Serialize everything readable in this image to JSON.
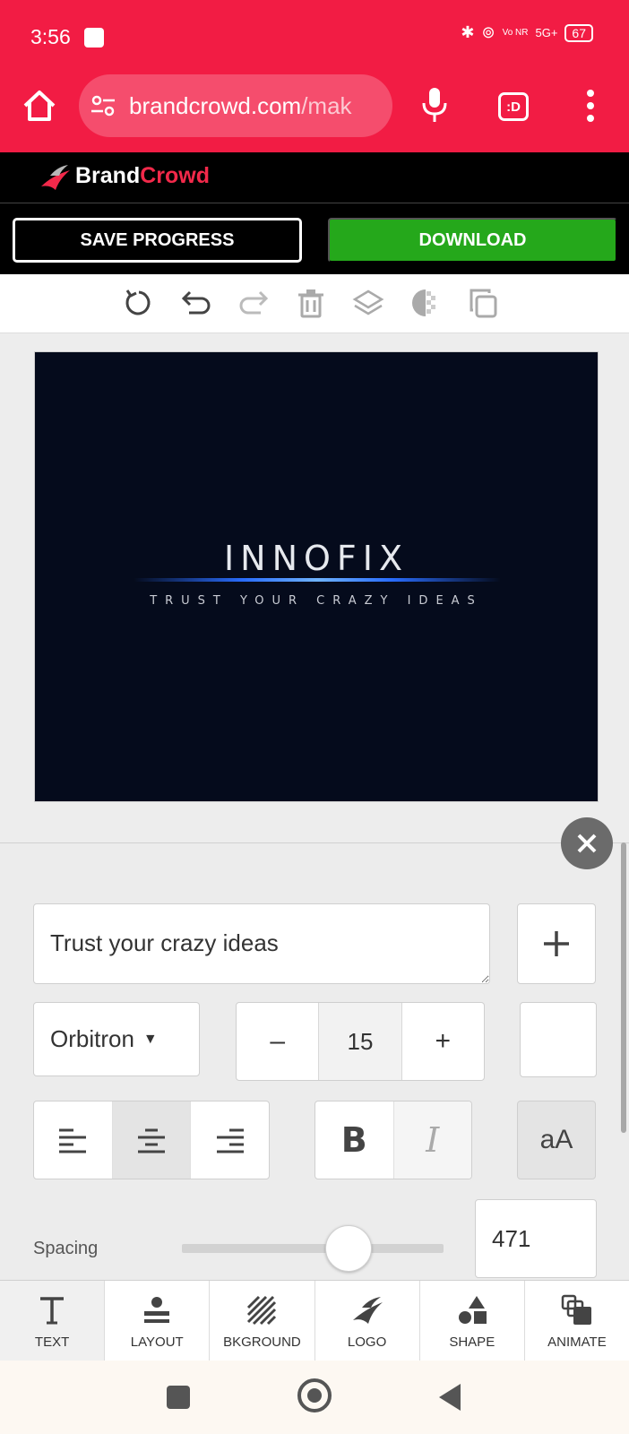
{
  "status_bar": {
    "time": "3:56",
    "network": "5G+",
    "volte": "Vo NR",
    "battery": "67"
  },
  "browser": {
    "url_main": "brandcrowd.com",
    "url_rest": "/mak",
    "tab_icon_label": ":D",
    "icons": [
      "home-icon",
      "site-settings-icon",
      "mic-icon",
      "tab-switcher-icon",
      "menu-icon"
    ]
  },
  "brand": {
    "name_part1": "Brand",
    "name_part2": "Crowd",
    "accent_color": "#f2294a"
  },
  "actions": {
    "save_label": "SAVE PROGRESS",
    "download_label": "DOWNLOAD",
    "download_color": "#25a81b"
  },
  "toolbar": {
    "icons": [
      "reset-icon",
      "undo-icon",
      "redo-icon",
      "delete-icon",
      "layers-icon",
      "transparency-icon",
      "duplicate-icon"
    ]
  },
  "artboard": {
    "background": "#050b1c",
    "title": "INNOFIX",
    "tagline": "TRUST YOUR CRAZY IDEAS"
  },
  "editor": {
    "text_value": "Trust your crazy ideas",
    "add_label": "+",
    "font_name": "Orbitron",
    "font_size": "15",
    "decrement_label": "–",
    "increment_label": "+",
    "alignment_selected": "center",
    "bold_label": "B",
    "italic_label": "I",
    "case_label": "aA",
    "spacing_label": "Spacing",
    "spacing_value": "471",
    "spacing_fraction": 0.6
  },
  "tabs": [
    {
      "label": "TEXT",
      "icon": "text-icon",
      "active": true
    },
    {
      "label": "LAYOUT",
      "icon": "layout-icon",
      "active": false
    },
    {
      "label": "BKGROUND",
      "icon": "background-icon",
      "active": false
    },
    {
      "label": "LOGO",
      "icon": "logo-icon",
      "active": false
    },
    {
      "label": "SHAPE",
      "icon": "shape-icon",
      "active": false
    },
    {
      "label": "ANIMATE",
      "icon": "animate-icon",
      "active": false
    }
  ]
}
